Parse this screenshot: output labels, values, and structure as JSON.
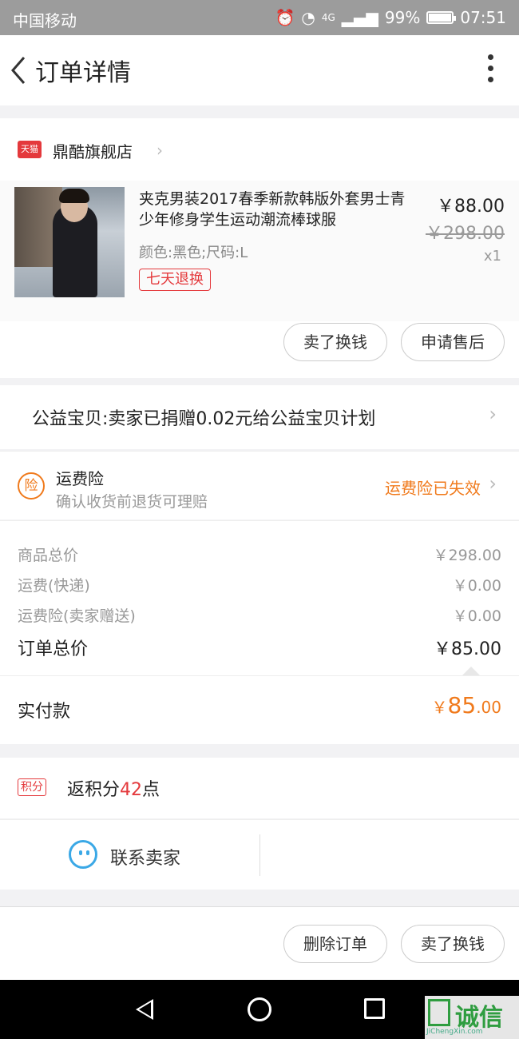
{
  "status_bar": {
    "carrier": "中国移动",
    "network": "4G",
    "battery": "99%",
    "battery_level": 0.99,
    "time": "07:51"
  },
  "header": {
    "title": "订单详情"
  },
  "shop": {
    "platform_badge": "天猫",
    "name": "鼎酷旗舰店"
  },
  "product": {
    "title": "夹克男装2017春季新款韩版外套男士青少年修身学生运动潮流棒球服",
    "spec": "颜色:黑色;尺码:L",
    "return_policy": "七天退换",
    "price": "￥88.00",
    "original_price": "￥298.00",
    "quantity": "x1"
  },
  "item_actions": {
    "sell_label": "卖了换钱",
    "after_sale_label": "申请售后"
  },
  "charity": {
    "text": "公益宝贝:卖家已捐赠0.02元给公益宝贝计划"
  },
  "insurance": {
    "icon_text": "险",
    "title": "运费险",
    "subtitle": "确认收货前退货可理赔",
    "status": "运费险已失效"
  },
  "summary": {
    "items_total_label": "商品总价",
    "items_total": "￥298.00",
    "shipping_label": "运费(快递)",
    "shipping": "￥0.00",
    "insurance_label": "运费险(卖家赠送)",
    "insurance": "￥0.00",
    "order_total_label": "订单总价",
    "order_total": "￥85.00"
  },
  "payment": {
    "label": "实付款",
    "currency": "￥",
    "amount_int": "85",
    "amount_dec": ".00"
  },
  "points": {
    "badge": "积分",
    "prefix": "返积分",
    "count": "42",
    "suffix": "点"
  },
  "contact": {
    "label": "联系卖家"
  },
  "bottom_actions": {
    "delete_label": "删除订单",
    "sell_label": "卖了换钱"
  },
  "watermark": {
    "text": "诚信",
    "url": "JiChengXin.com"
  },
  "colors": {
    "accent_orange": "#f07a1c",
    "accent_red": "#e4393c",
    "chat_blue": "#3aa8e6"
  }
}
